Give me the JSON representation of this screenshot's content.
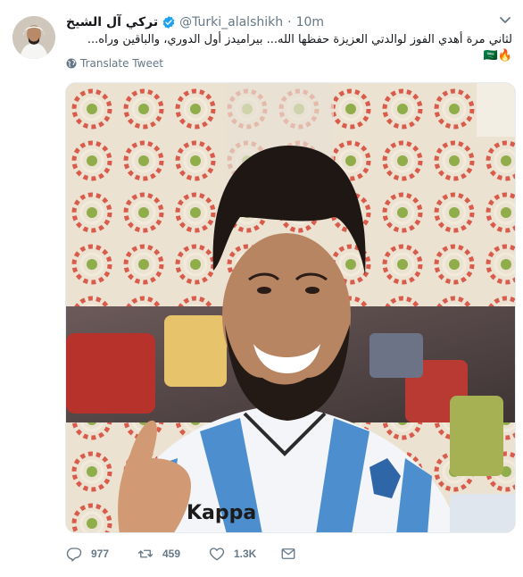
{
  "tweet": {
    "display_name": "تركي آل الشيخ",
    "handle": "@Turki_alalshikh",
    "separator": "·",
    "time": "10m",
    "text_line1": "لثاني مرة أهدي الفوز لوالدتي العزيزة حفظها الله... بيراميدز أول الدوري، والباقين وراه...",
    "text_line2": "🔥🇸🇦",
    "translate_label": "Translate Tweet",
    "counts": {
      "replies": "977",
      "retweets": "459",
      "likes": "1.3K"
    },
    "icons": {
      "verified": "verified-badge-icon",
      "chevron": "chevron-down-icon",
      "translate": "globe-icon",
      "reply": "reply-icon",
      "retweet": "retweet-icon",
      "like": "heart-icon",
      "dm": "envelope-icon"
    },
    "colors": {
      "verified_blue": "#1da1f2",
      "muted": "#657786",
      "text": "#14171a"
    }
  }
}
